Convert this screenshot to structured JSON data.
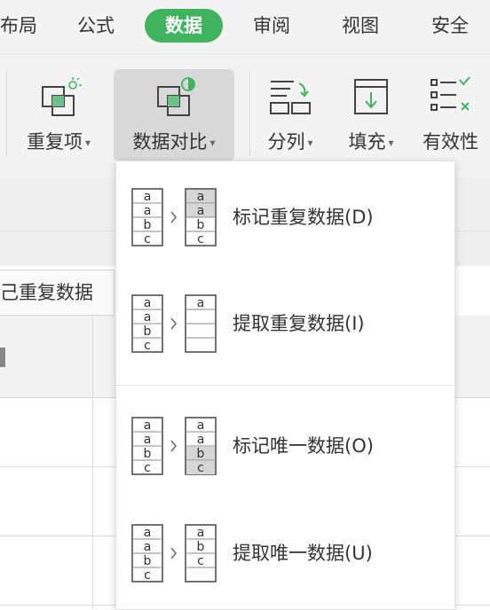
{
  "menu": {
    "tabs": [
      "布局",
      "公式",
      "数据",
      "审阅",
      "视图",
      "安全"
    ],
    "active_index": 2
  },
  "ribbon": {
    "duplicates_label": "重复项",
    "compare_label": "数据对比",
    "split_label": "分列",
    "fill_label": "填充",
    "validity_label": "有效性"
  },
  "name_box": {
    "value": "己重复数据"
  },
  "dropdown": {
    "items": [
      {
        "label": "标记重复数据(D)",
        "left": [
          "a",
          "a",
          "b",
          "c"
        ],
        "right": [
          "a",
          "a",
          "b",
          "c"
        ],
        "right_highlight": [
          0,
          1
        ]
      },
      {
        "label": "提取重复数据(I)",
        "left": [
          "a",
          "a",
          "b",
          "c"
        ],
        "right": [
          "a",
          "",
          "",
          ""
        ],
        "right_highlight": []
      },
      {
        "label": "标记唯一数据(O)",
        "left": [
          "a",
          "a",
          "b",
          "c"
        ],
        "right": [
          "a",
          "a",
          "b",
          "c"
        ],
        "right_highlight": [
          2,
          3
        ]
      },
      {
        "label": "提取唯一数据(U)",
        "left": [
          "a",
          "a",
          "b",
          "c"
        ],
        "right": [
          "a",
          "b",
          "c",
          ""
        ],
        "right_highlight": []
      }
    ]
  },
  "colors": {
    "accent_green": "#3fb35e",
    "cell_highlight": "#d6d6d6"
  }
}
